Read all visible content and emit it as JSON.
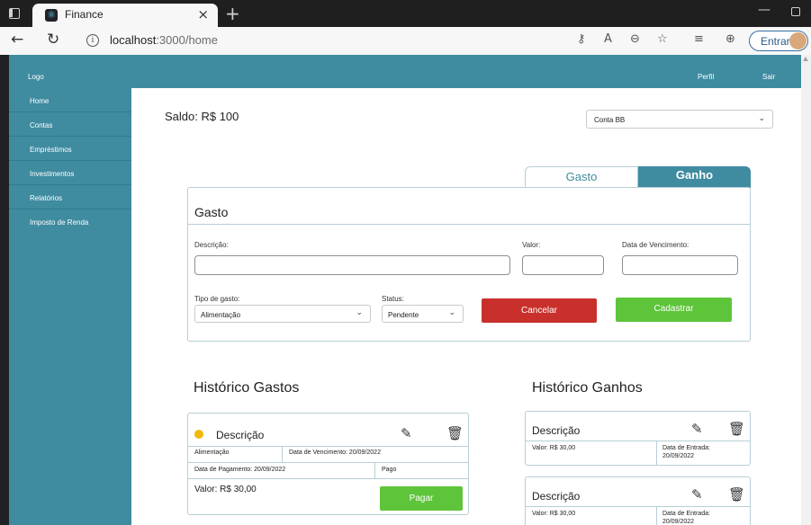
{
  "browser": {
    "tab_title": "Finance",
    "url_host": "localhost",
    "url_path": ":3000/home",
    "signin_label": "Entrar",
    "icons": {
      "tab_close": "×",
      "new_tab": "+",
      "minimize": "—",
      "back": "←",
      "refresh": "↻",
      "info": "i",
      "key": "⚷",
      "read_aloud": "A",
      "zoom": "⊖",
      "favorites_add": "☆",
      "favorites": "≡",
      "collections": "⊕"
    }
  },
  "navbar": {
    "logo": "Logo",
    "perfil": "Perfil",
    "sair": "Sair"
  },
  "sidebar": {
    "items": [
      {
        "label": "Home"
      },
      {
        "label": "Contas"
      },
      {
        "label": "Empréstimos"
      },
      {
        "label": "Investimentos"
      },
      {
        "label": "Relatórios"
      },
      {
        "label": "Imposto de Renda"
      }
    ]
  },
  "main": {
    "saldo": "Saldo: R$ 100",
    "conta_select": "Conta BB",
    "tabs": {
      "gasto": "Gasto",
      "ganho": "Ganho"
    },
    "active_tab": "Ganho"
  },
  "form": {
    "title": "Gasto",
    "descricao_label": "Descrição:",
    "valor_label": "Valor:",
    "vencimento_label": "Data de Vencimento:",
    "descricao_value": "",
    "valor_value": "",
    "vencimento_value": "",
    "tipo_label": "Tipo de gasto:",
    "tipo_value": "Alimentação",
    "status_label": "Status:",
    "status_value": "Pendente",
    "cancel_label": "Cancelar",
    "submit_label": "Cadastrar"
  },
  "colors": {
    "primary": "#3f8ba0",
    "cancel": "#c9302c",
    "success": "#5ec43a",
    "pending_dot": "#f0b90b"
  },
  "historico_gastos": {
    "title": "Histórico Gastos",
    "items": [
      {
        "descricao": "Descrição",
        "tipo": "Alimentação",
        "vencimento": "Data de Vencimento: 20/09/2022",
        "pagamento": "Data de Pagamento: 20/09/2022",
        "status": "Pago",
        "valor": "Valor: R$ 30,00",
        "pay_label": "Pagar"
      }
    ]
  },
  "historico_ganhos": {
    "title": "Histórico Ganhos",
    "items": [
      {
        "descricao": "Descrição",
        "valor": "Valor: R$ 30,00",
        "entrada_label": "Data de Entrada:",
        "entrada_date": "20/09/2022"
      },
      {
        "descricao": "Descrição",
        "valor": "Valor: R$ 30,00",
        "entrada_label": "Data de Entrada:",
        "entrada_date": "20/09/2022"
      }
    ]
  },
  "card_icons": {
    "edit": "✎",
    "delete": "🗑"
  }
}
